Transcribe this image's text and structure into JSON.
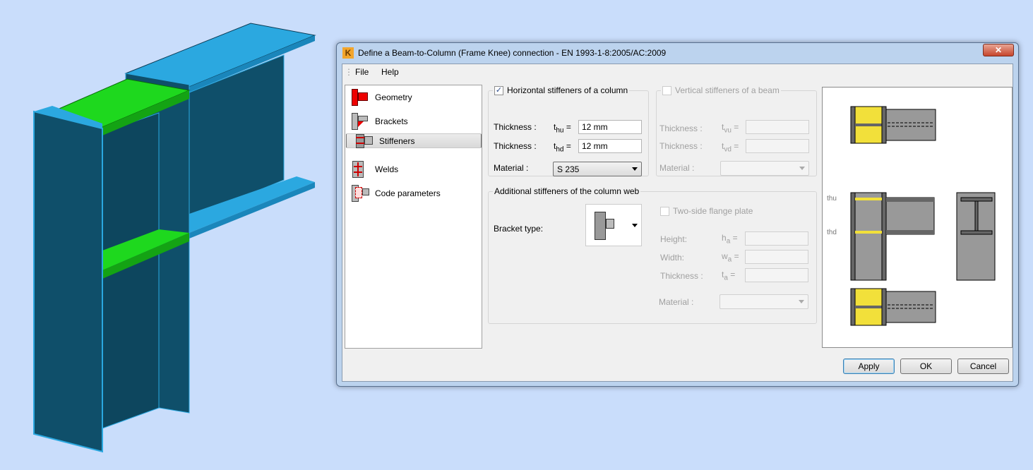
{
  "window": {
    "title": "Define a Beam-to-Column (Frame Knee) connection - EN 1993-1-8:2005/AC:2009",
    "close_icon": "close-x-icon",
    "app_icon": "K"
  },
  "menu": [
    {
      "label": "File"
    },
    {
      "label": "Help"
    }
  ],
  "nav": {
    "selected": "Stiffeners",
    "items": [
      {
        "label": "Geometry",
        "icon": "geometry-icon"
      },
      {
        "label": "Brackets",
        "icon": "brackets-icon"
      },
      {
        "label": "Stiffeners",
        "icon": "stiffeners-icon"
      },
      {
        "label": "Welds",
        "icon": "welds-icon"
      },
      {
        "label": "Code parameters",
        "icon": "code-parameters-icon"
      }
    ]
  },
  "horizontal": {
    "title": "Horizontal stiffeners of a column",
    "checked": true,
    "thickness_label": "Thickness :",
    "thu_sym": "t",
    "thu_sub": "hu",
    "thu_eq": "=",
    "thu_value": "12 mm",
    "thd_sym": "t",
    "thd_sub": "hd",
    "thd_eq": "=",
    "thd_value": "12 mm",
    "material_label": "Material :",
    "material_value": "S 235"
  },
  "vertical": {
    "title": "Vertical stiffeners of a beam",
    "checked": false,
    "thickness_label": "Thickness :",
    "tvu_sym": "t",
    "tvu_sub": "vu",
    "eq": "=",
    "tvd_sym": "t",
    "tvd_sub": "vd",
    "material_label": "Material :"
  },
  "additional": {
    "title": "Additional stiffeners of the column web",
    "bracket_type_label": "Bracket type:",
    "two_side_label": "Two-side flange plate",
    "two_side_checked": false,
    "height_label": "Height:",
    "ha_sym": "h",
    "ha_sub": "a",
    "width_label": "Width:",
    "wa_sym": "w",
    "wa_sub": "a",
    "thickness_label": "Thickness :",
    "ta_sym": "t",
    "ta_sub": "a",
    "eq": "=",
    "material_label": "Material :"
  },
  "preview": {
    "thu_label": "thu",
    "thd_label": "thd"
  },
  "buttons": {
    "apply": "Apply",
    "ok": "OK",
    "cancel": "Cancel"
  },
  "colors": {
    "background": "#c9ddfb",
    "steel": "#0f4f6a",
    "flange": "#2ba8e0",
    "stiffener": "#1ed81e",
    "preview_stiffener": "#f2e03a"
  }
}
